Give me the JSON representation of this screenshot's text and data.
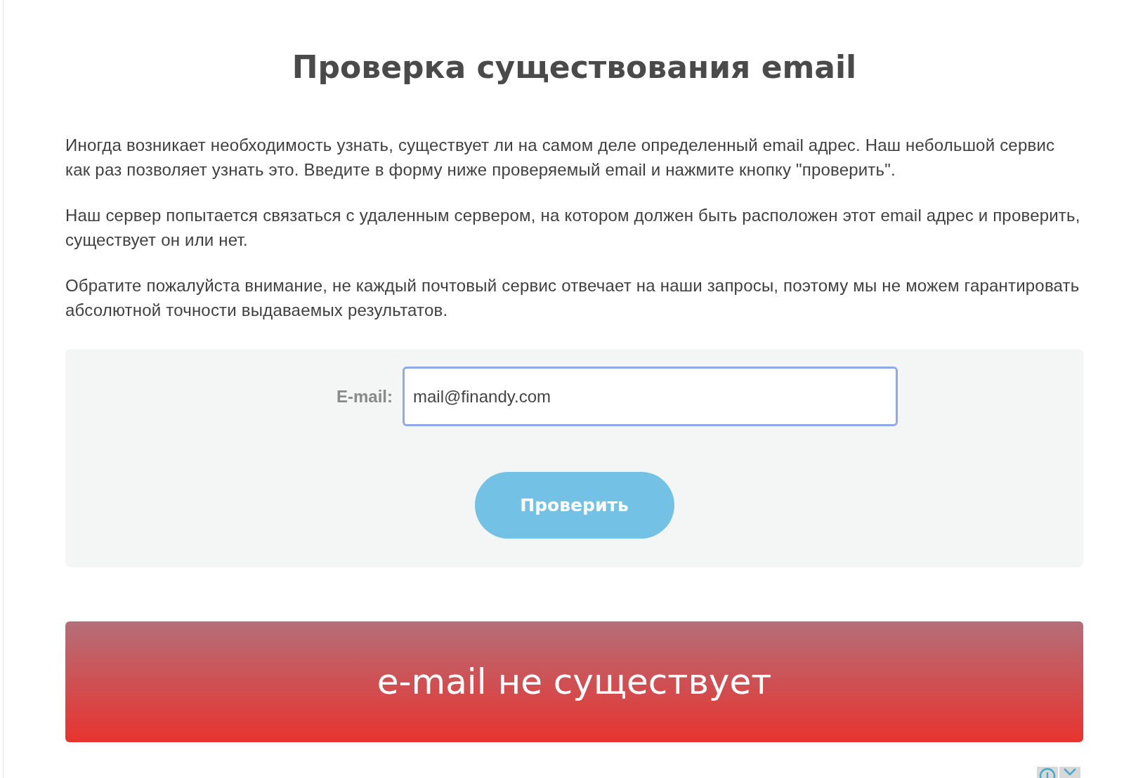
{
  "title": "Проверка существования email",
  "paragraphs": [
    "Иногда возникает необходимость узнать, существует ли на самом деле определенный email адрес. Наш небольшой сервис как раз позволяет узнать это. Введите в форму ниже проверяемый email и нажмите кнопку \"проверить\".",
    "Наш сервер попытается связаться с удаленным сервером, на котором должен быть расположен этот email адрес и проверить, существует он или нет.",
    "Обратите пожалуйста внимание, не каждый почтовый сервис отвечает на наши запросы, поэтому мы не можем гарантировать абсолютной точности выдаваемых результатов."
  ],
  "form": {
    "label": "E-mail:",
    "value": "mail@finandy.com",
    "focused": true,
    "button": "Проверить"
  },
  "result": {
    "error": true,
    "text": "e-mail не существует"
  }
}
